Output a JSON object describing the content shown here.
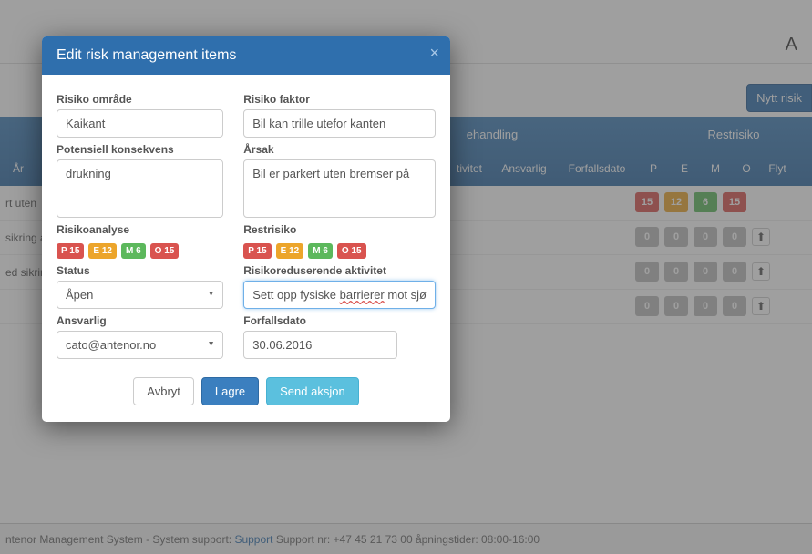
{
  "header": {
    "a": "A"
  },
  "toolbar": {
    "new_risk": "Nytt risik"
  },
  "band": {
    "group_mid": "ehandling",
    "group_right": "Restrisiko",
    "cols": {
      "ar": "År",
      "tivitet": "tivitet",
      "ansvarlig": "Ansvarlig",
      "forfall": "Forfallsdato",
      "p": "P",
      "e": "E",
      "m": "M",
      "o": "O",
      "flytt": "Flyt"
    }
  },
  "rows": [
    {
      "text": "rt uten",
      "p": "15",
      "e": "12",
      "m": "6",
      "o": "15",
      "color": true
    },
    {
      "text": "sikring a",
      "p": "0",
      "e": "0",
      "m": "0",
      "o": "0",
      "color": false
    },
    {
      "text": "ed sikrin",
      "p": "0",
      "e": "0",
      "m": "0",
      "o": "0",
      "color": false
    },
    {
      "text": "",
      "p": "0",
      "e": "0",
      "m": "0",
      "o": "0",
      "color": false
    }
  ],
  "footer": {
    "text1": "ntenor Management System - System support: ",
    "link": "Support",
    "text2": " Support nr: +47 45 21 73 00 åpningstider: 08:00-16:00"
  },
  "modal": {
    "title": "Edit risk management items",
    "labels": {
      "omrade": "Risiko område",
      "faktor": "Risiko faktor",
      "konsekvens": "Potensiell konsekvens",
      "arsak": "Årsak",
      "analyse": "Risikoanalyse",
      "restrisiko": "Restrisiko",
      "status": "Status",
      "aktivitet": "Risikoreduserende aktivitet",
      "ansvarlig": "Ansvarlig",
      "forfall": "Forfallsdato"
    },
    "values": {
      "omrade": "Kaikant",
      "faktor": "Bil kan trille utefor kanten",
      "konsekvens": "drukning",
      "arsak": "Bil er parkert uten bremser på",
      "status": "Åpen",
      "aktivitet_pre": "Sett opp fysiske ",
      "aktivitet_mid": "barrierer",
      "aktivitet_post": " mot sjø",
      "ansvarlig": "cato@antenor.no",
      "forfall": "30.06.2016"
    },
    "analyse_badges": {
      "p": "P 15",
      "e": "E 12",
      "m": "M 6",
      "o": "O 15"
    },
    "rest_badges": {
      "p": "P 15",
      "e": "E 12",
      "m": "M 6",
      "o": "O 15"
    },
    "buttons": {
      "cancel": "Avbryt",
      "save": "Lagre",
      "send": "Send aksjon"
    }
  }
}
